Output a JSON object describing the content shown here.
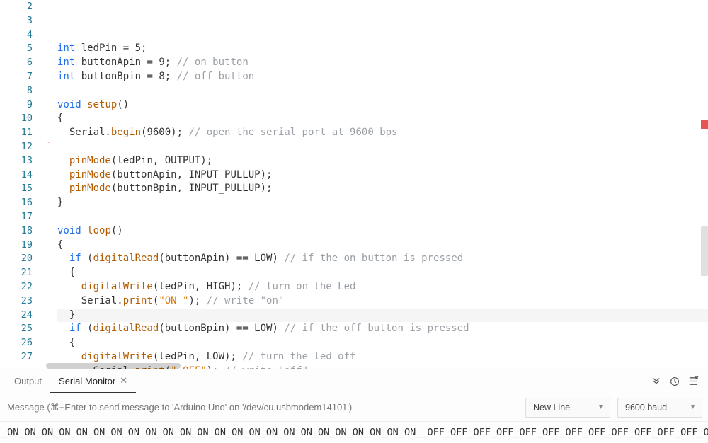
{
  "editor": {
    "lines": [
      {
        "n": 2,
        "html": ""
      },
      {
        "n": 3,
        "html": "<span class='ty'>int</span> ledPin = <span class='num'>5</span>;"
      },
      {
        "n": 4,
        "html": "<span class='ty'>int</span> buttonApin = <span class='num'>9</span>; <span class='cm'>// on button</span>"
      },
      {
        "n": 5,
        "html": "<span class='ty'>int</span> buttonBpin = <span class='num'>8</span>; <span class='cm'>// off button</span>"
      },
      {
        "n": 6,
        "html": ""
      },
      {
        "n": 7,
        "html": "<span class='ty'>void</span> <span class='fn2'>setup</span>()"
      },
      {
        "n": 8,
        "html": "{"
      },
      {
        "n": 9,
        "html": "  Serial.<span class='fn2'>begin</span>(<span class='num'>9600</span>); <span class='cm'>// open the serial port at 9600 bps</span>"
      },
      {
        "n": 10,
        "html": "",
        "err": true
      },
      {
        "n": 11,
        "html": "  <span class='fn2'>pinMode</span>(ledPin, OUTPUT);"
      },
      {
        "n": 12,
        "html": "  <span class='fn2'>pinMode</span>(buttonApin, INPUT_PULLUP);"
      },
      {
        "n": 13,
        "html": "  <span class='fn2'>pinMode</span>(buttonBpin, INPUT_PULLUP);"
      },
      {
        "n": 14,
        "html": "}"
      },
      {
        "n": 15,
        "html": ""
      },
      {
        "n": 16,
        "html": "<span class='ty'>void</span> <span class='fn2'>loop</span>()"
      },
      {
        "n": 17,
        "html": "{"
      },
      {
        "n": 18,
        "html": "  <span class='kw'>if</span> (<span class='fn2'>digitalRead</span>(buttonApin) == LOW) <span class='cm'>// if the on button is pressed</span>"
      },
      {
        "n": 19,
        "html": "  {"
      },
      {
        "n": 20,
        "html": "    <span class='fn2'>digitalWrite</span>(ledPin, HIGH); <span class='cm'>// turn on the Led</span>"
      },
      {
        "n": 21,
        "html": "    Serial.<span class='fn2'>print</span>(<span class='str'>\"ON_\"</span>); <span class='cm'>// write \"on\"</span>"
      },
      {
        "n": 22,
        "html": "  }",
        "hl": true
      },
      {
        "n": 23,
        "html": "  <span class='kw'>if</span> (<span class='fn2'>digitalRead</span>(buttonBpin) == LOW) <span class='cm'>// if the off button is pressed</span>"
      },
      {
        "n": 24,
        "html": "  {"
      },
      {
        "n": 25,
        "html": "    <span class='fn2'>digitalWrite</span>(ledPin, LOW); <span class='cm'>// turn the led off</span>"
      },
      {
        "n": 26,
        "html": "      Serial.<span class='fn2'>print</span>(<span class='str'>\"_OFF\"</span>); <span class='cm'>// write \"off\"</span>"
      },
      {
        "n": 27,
        "html": "  }"
      }
    ]
  },
  "panel": {
    "tabs": {
      "output": "Output",
      "monitor": "Serial Monitor"
    },
    "message_placeholder": "Message (⌘+Enter to send message to 'Arduino Uno' on '/dev/cu.usbmodem14101')",
    "line_ending": "New Line",
    "baud": "9600 baud",
    "console_text": "_ON_ON_ON_ON_ON_ON_ON_ON_ON_ON_ON_ON_ON_ON_ON_ON_ON_ON_ON_ON_ON_ON_ON_ON__OFF_OFF_OFF_OFF_OFF_OFF_OFF_OFF_OFF_OFF_OFF_OFF_OFF_OFF_OFF_OFF_OFF"
  }
}
